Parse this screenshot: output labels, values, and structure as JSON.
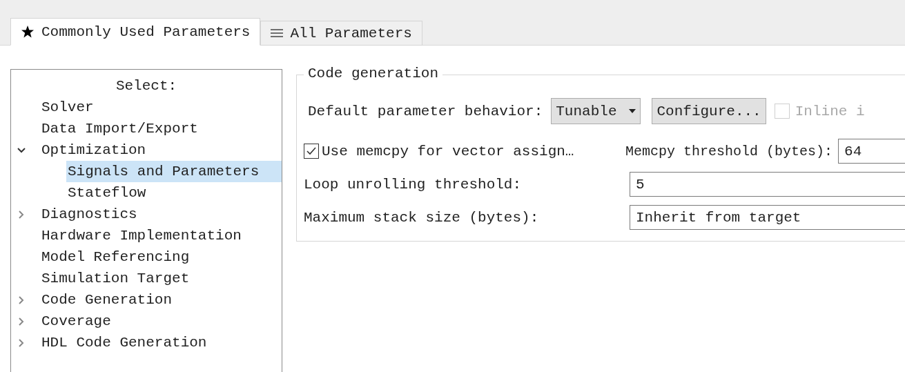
{
  "tabs": [
    {
      "label": "Commonly Used Parameters",
      "selected": true
    },
    {
      "label": "All Parameters",
      "selected": false
    }
  ],
  "tree": {
    "heading": "Select:",
    "items": [
      {
        "label": "Solver",
        "selected": false
      },
      {
        "label": "Data Import/Export",
        "selected": false
      },
      {
        "label": "Optimization",
        "selected": false,
        "expanded": true,
        "children": [
          {
            "label": "Signals and Parameters",
            "selected": true
          },
          {
            "label": "Stateflow",
            "selected": false
          }
        ]
      },
      {
        "label": "Diagnostics",
        "selected": false,
        "expanded": false
      },
      {
        "label": "Hardware Implementation",
        "selected": false
      },
      {
        "label": "Model Referencing",
        "selected": false
      },
      {
        "label": "Simulation Target",
        "selected": false
      },
      {
        "label": "Code Generation",
        "selected": false,
        "expanded": false
      },
      {
        "label": "Coverage",
        "selected": false,
        "expanded": false
      },
      {
        "label": "HDL Code Generation",
        "selected": false,
        "expanded": false
      }
    ]
  },
  "group": {
    "title": "Code generation",
    "behavior": {
      "label": "Default parameter behavior:",
      "value": "Tunable",
      "button": "Configure...",
      "inline": {
        "label": "Inline i",
        "checked": false,
        "disabled": true
      }
    },
    "memcpy": {
      "label": "Use memcpy for vector assign…",
      "checked": true,
      "threshold_label": "Memcpy threshold (bytes):",
      "threshold_value": "64"
    },
    "fields": [
      {
        "label": "Loop unrolling threshold:",
        "value": "5"
      },
      {
        "label": "Maximum stack size (bytes):",
        "value": "Inherit from target"
      }
    ]
  }
}
